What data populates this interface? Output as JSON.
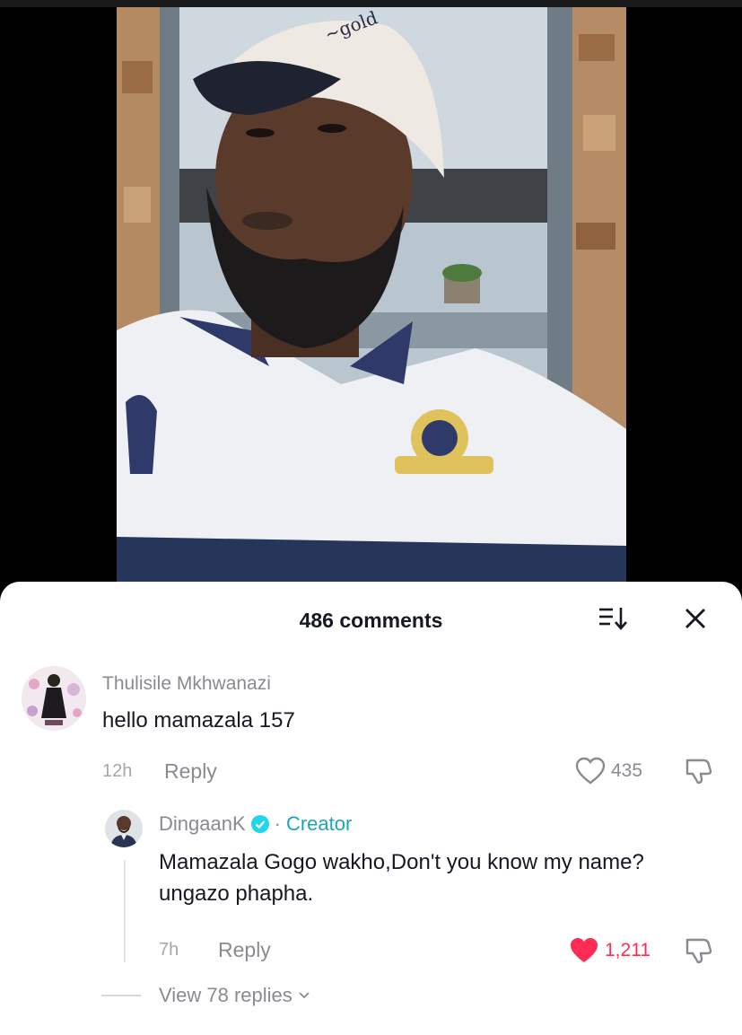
{
  "comments_sheet": {
    "title": "486 comments",
    "icons": {
      "sort": "sort-icon",
      "close": "close-icon"
    }
  },
  "comment": {
    "username": "Thulisile Mkhwanazi",
    "text": "hello mamazala 157",
    "time": "12h",
    "reply_label": "Reply",
    "likes": "435"
  },
  "reply": {
    "username": "DingaanK",
    "separator": "·",
    "badge": "Creator",
    "text": "Mamazala Gogo wakho,Don't you know my name? ungazo phapha.",
    "time": "7h",
    "reply_label": "Reply",
    "likes": "1,211"
  },
  "view_replies": "View 78 replies",
  "colors": {
    "accent_red": "#fe2c55",
    "creator_teal": "#20a4b5",
    "text_dark": "#161823",
    "text_gray": "#8a8b91"
  }
}
